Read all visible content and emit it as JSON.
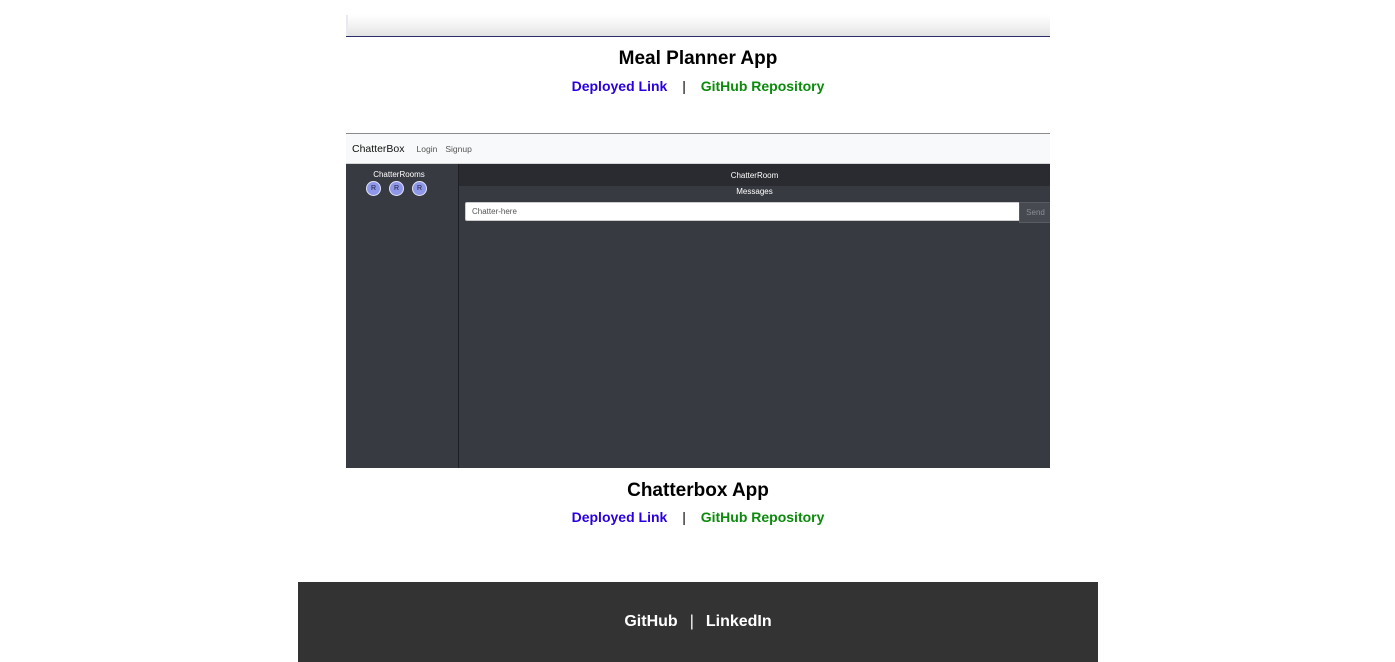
{
  "projects": [
    {
      "title": "Meal Planner App",
      "deployed_label": "Deployed Link",
      "github_label": "GitHub Repository"
    },
    {
      "title": "Chatterbox App",
      "deployed_label": "Deployed Link",
      "github_label": "GitHub Repository"
    }
  ],
  "separator": "|",
  "chatterbox_screenshot": {
    "brand": "ChatterBox",
    "nav_links": [
      "Login",
      "Signup"
    ],
    "sidebar_title": "ChatterRooms",
    "rooms": [
      "R",
      "R",
      "R"
    ],
    "room_header": "ChatterRoom",
    "messages_label": "Messages",
    "input_placeholder": "Chatter-here",
    "send_label": "Send"
  },
  "footer": {
    "github_label": "GitHub",
    "linkedin_label": "LinkedIn"
  },
  "colors": {
    "deployed_link": "#2a00e0",
    "github_link": "#0b8a0b",
    "footer_bg": "#333333",
    "chat_bg": "#383a42"
  }
}
